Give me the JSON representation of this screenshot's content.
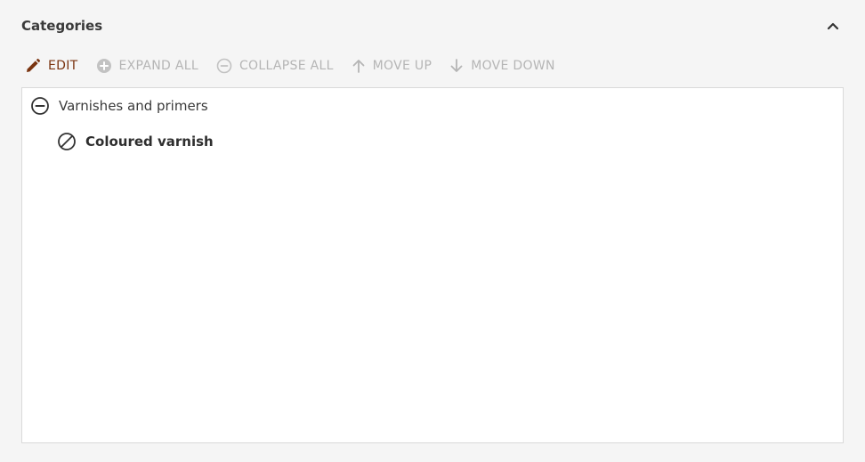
{
  "panel": {
    "title": "Categories"
  },
  "toolbar": {
    "edit_label": "EDIT",
    "expand_all_label": "EXPAND ALL",
    "collapse_all_label": "COLLAPSE ALL",
    "move_up_label": "MOVE UP",
    "move_down_label": "MOVE DOWN"
  },
  "tree": {
    "items": [
      {
        "label": "Varnishes and primers",
        "icon": "minus-circle-icon",
        "state": "expanded"
      },
      {
        "label": "Coloured varnish",
        "icon": "no-children-icon",
        "state": "leaf"
      }
    ]
  },
  "colors": {
    "accent": "#7a3410",
    "disabled": "#b5b5b5",
    "text": "#3a3a3a",
    "border": "#d9d9d9",
    "background": "#f5f5f5"
  }
}
